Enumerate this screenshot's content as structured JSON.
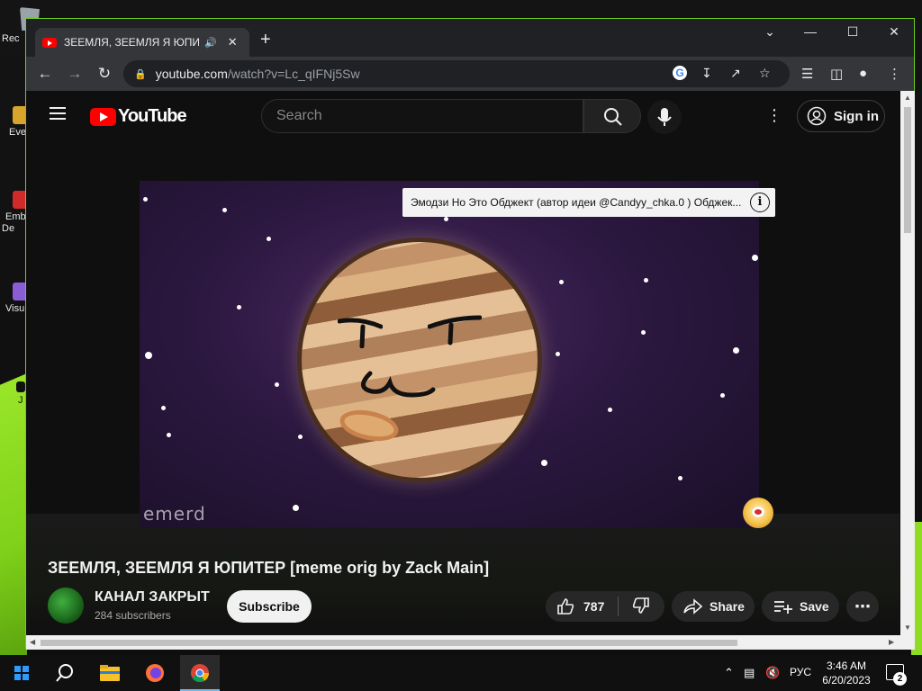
{
  "browser": {
    "tab_title": "ЗЕЕМЛЯ, ЗЕЕМЛЯ Я ЮПИТЕ",
    "url_host": "youtube.com",
    "url_path": "/watch?v=Lc_qIFNj5Sw",
    "new_tab_label": "+"
  },
  "desktop": {
    "icons": [
      {
        "label": "Rec"
      },
      {
        "label": "Eve"
      },
      {
        "label": "Emb De"
      },
      {
        "label": "Visu"
      },
      {
        "label": "J"
      }
    ]
  },
  "youtube": {
    "logo_text": "YouTube",
    "search_placeholder": "Search",
    "sign_in_label": "Sign in",
    "overlay_text": "Эмодзи Но Это Обджект (автор идеи @Candyy_chka.0 ) Обджек...",
    "overlay_info": "i",
    "watermark": "emerd",
    "video_title": "ЗЕЕМЛЯ, ЗЕЕМЛЯ Я ЮПИТЕР [meme orig by Zack Main]",
    "channel_name": "КАНАЛ ЗАКРЫТ",
    "subscribers": "284 subscribers",
    "subscribe_label": "Subscribe",
    "likes": "787",
    "share_label": "Share",
    "save_label": "Save"
  },
  "taskbar": {
    "time": "3:46 AM",
    "date": "6/20/2023",
    "language": "РУС",
    "notification_count": "2"
  },
  "icons": [
    "windows-start-icon",
    "search-icon",
    "file-explorer-icon",
    "firefox-icon",
    "chrome-icon",
    "google-icon",
    "install-icon",
    "share-icon",
    "star-icon",
    "media-icon",
    "sidepanel-icon",
    "profile-icon",
    "mic-icon",
    "like-icon",
    "dislike-icon",
    "save-icon"
  ]
}
